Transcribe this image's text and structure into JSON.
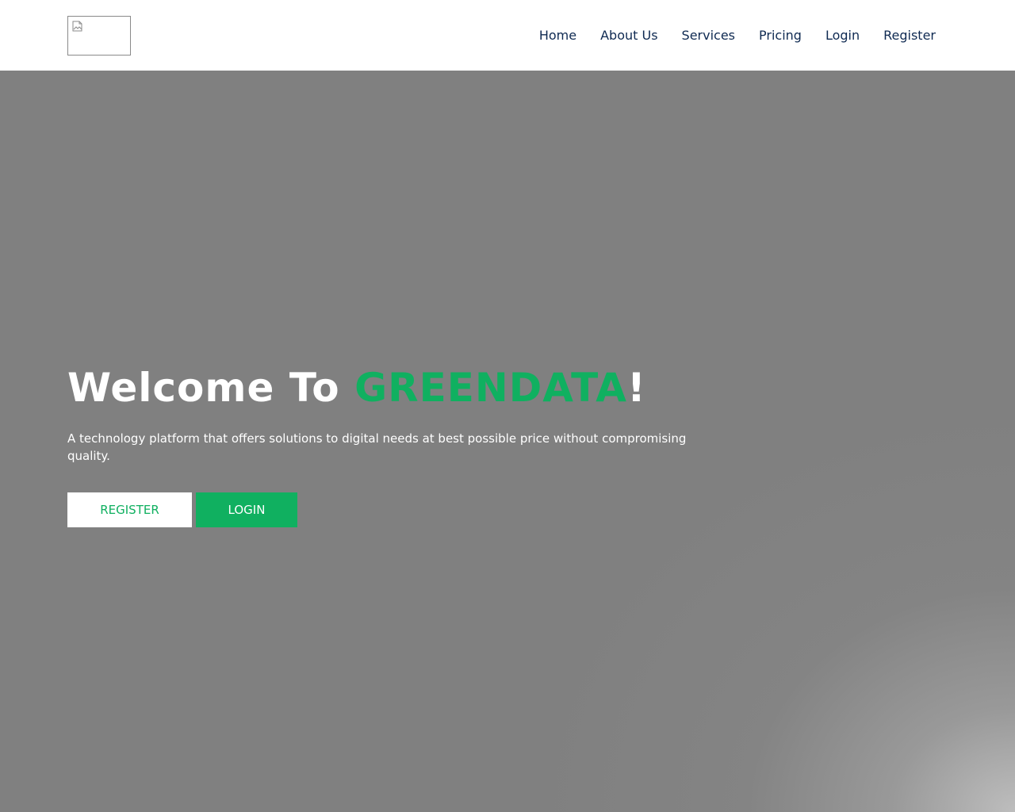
{
  "nav": {
    "items": [
      {
        "label": "Home"
      },
      {
        "label": "About Us"
      },
      {
        "label": "Services"
      },
      {
        "label": "Pricing"
      },
      {
        "label": "Login"
      },
      {
        "label": "Register"
      }
    ]
  },
  "hero": {
    "title_prefix": "Welcome To ",
    "title_brand": "GREENDATA",
    "title_suffix": "!",
    "description": "A technology platform that offers solutions to digital needs at best possible price without compromising quality.",
    "register_label": "REGISTER",
    "login_label": "LOGIN"
  },
  "colors": {
    "brand": "#10b060",
    "nav_text": "#0f2a52",
    "hero_bg": "#808080"
  },
  "icons": {
    "logo": "broken-image-icon"
  }
}
